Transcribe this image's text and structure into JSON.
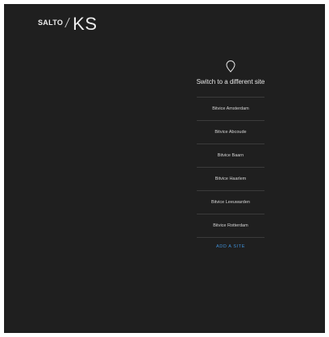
{
  "brand": {
    "salto": "SALTO",
    "ks": "KS"
  },
  "site_switcher": {
    "icon": "map-pin-icon",
    "title": "Switch to a different site",
    "sites": [
      "Bitvice Amsterdam",
      "Bitvice Abcoude",
      "Bitvice Baarn",
      "Bitvice Haarlem",
      "Bitvice Leeuwarden",
      "Bitvice Rotterdam"
    ],
    "add_site": "ADD A SITE"
  },
  "colors": {
    "background": "#1f1f1f",
    "text": "#e6e6e6",
    "divider": "#3b3b3b",
    "accent": "#3f8fd6"
  }
}
